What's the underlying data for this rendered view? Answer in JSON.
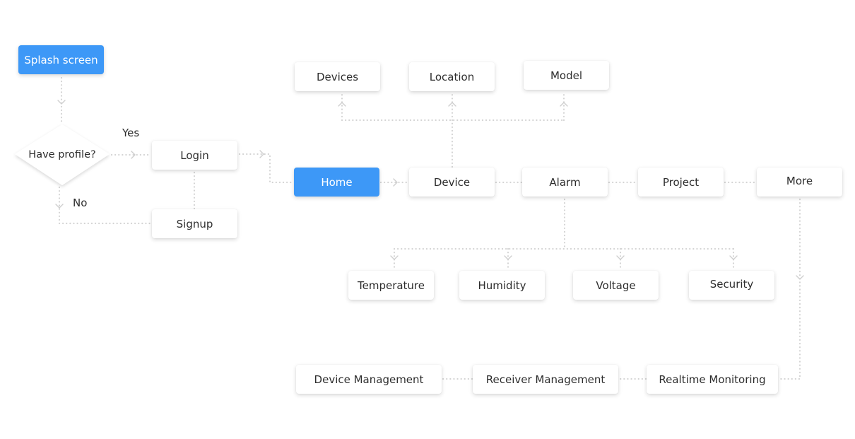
{
  "diagram": {
    "type": "flowchart",
    "accent_color": "#3d98f7",
    "connector_color": "#d4d4d4",
    "start": {
      "label": "Splash screen"
    },
    "decision": {
      "label": "Have profile?"
    },
    "edge_labels": {
      "yes": "Yes",
      "no": "No"
    },
    "auth": {
      "login": "Login",
      "signup": "Signup"
    },
    "home": {
      "label": "Home"
    },
    "device_children": [
      "Devices",
      "Location",
      "Model"
    ],
    "main_nav": [
      "Device",
      "Alarm",
      "Project",
      "More"
    ],
    "alarm_children": [
      "Temperature",
      "Humidity",
      "Voltage",
      "Security"
    ],
    "more_children": [
      "Device Management",
      "Receiver Management",
      "Realtime Monitoring"
    ]
  }
}
